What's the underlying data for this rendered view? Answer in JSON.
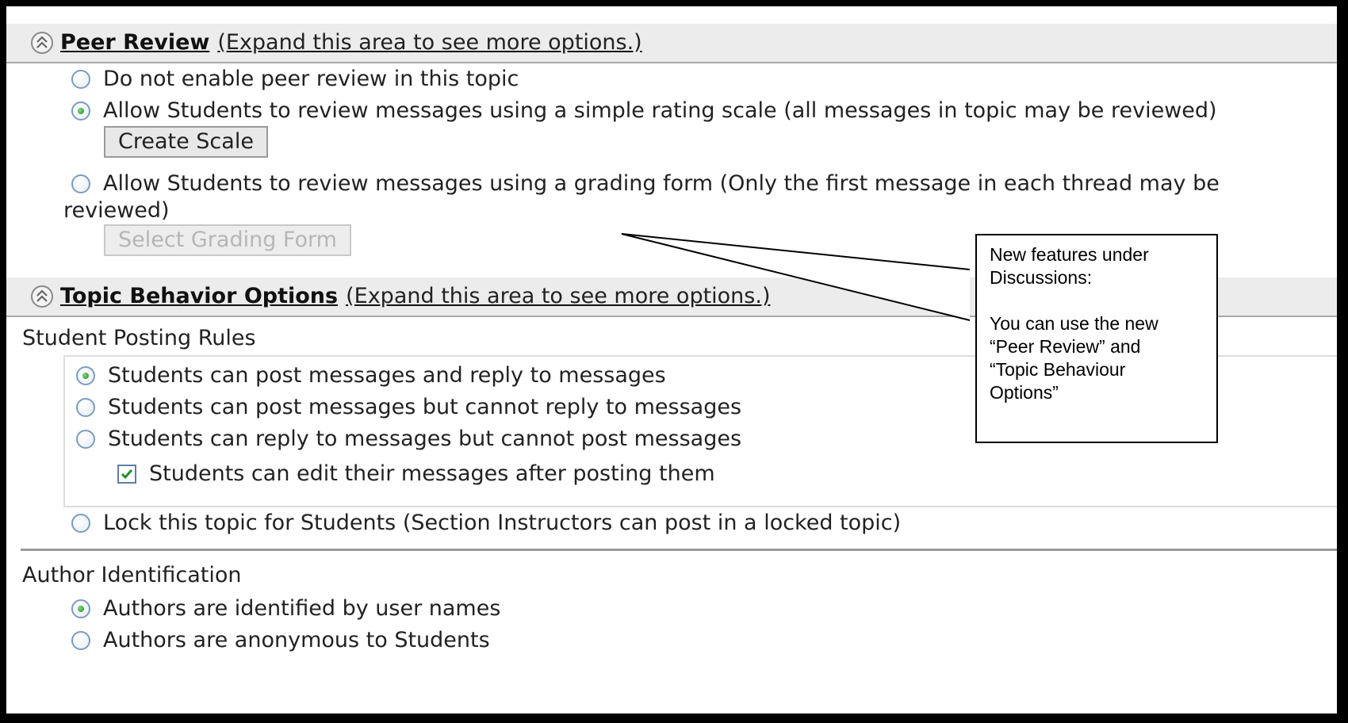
{
  "peer_review": {
    "title": "Peer Review",
    "note": "(Expand this area to see more options.)",
    "options": [
      {
        "label": "Do not enable peer review in this topic",
        "selected": false
      },
      {
        "label": "Allow Students to review messages using a simple rating scale (all messages in topic may be reviewed)",
        "selected": true
      },
      {
        "label": "Allow Students to review messages using a grading form (Only the first message in each thread may be",
        "label_cont": "reviewed)",
        "selected": false
      }
    ],
    "create_scale_label": "Create Scale",
    "select_grading_form_label": "Select Grading Form"
  },
  "topic_behavior": {
    "title": "Topic Behavior Options",
    "note": "(Expand this area to see more options.)",
    "posting_rules_label": "Student Posting Rules",
    "posting_options": [
      {
        "label": "Students can post messages and reply to messages",
        "selected": true
      },
      {
        "label": "Students can post messages but cannot reply to messages",
        "selected": false
      },
      {
        "label": "Students can reply to messages but cannot post messages",
        "selected": false
      }
    ],
    "edit_checkbox": {
      "label": "Students can edit their messages after posting them",
      "checked": true
    },
    "lock_option": {
      "label": "Lock this topic for Students (Section Instructors can post in a locked topic)",
      "selected": false
    },
    "author_id_label": "Author Identification",
    "author_options": [
      {
        "label": "Authors are identified by user names",
        "selected": true
      },
      {
        "label": "Authors are anonymous to Students",
        "selected": false
      }
    ]
  },
  "callout": {
    "line1": "New features under",
    "line2": "Discussions:",
    "line3": "You can use the new",
    "line4": "“Peer Review” and",
    "line5": "“Topic Behaviour",
    "line6": "Options”"
  },
  "icons": {
    "collapse": "chevron-double-up-icon",
    "radio": "radio-button",
    "check": "checkmark-icon"
  },
  "colors": {
    "header_bg": "#ececec",
    "radio_selected": "#1f8f2a",
    "frame": "#000000"
  }
}
